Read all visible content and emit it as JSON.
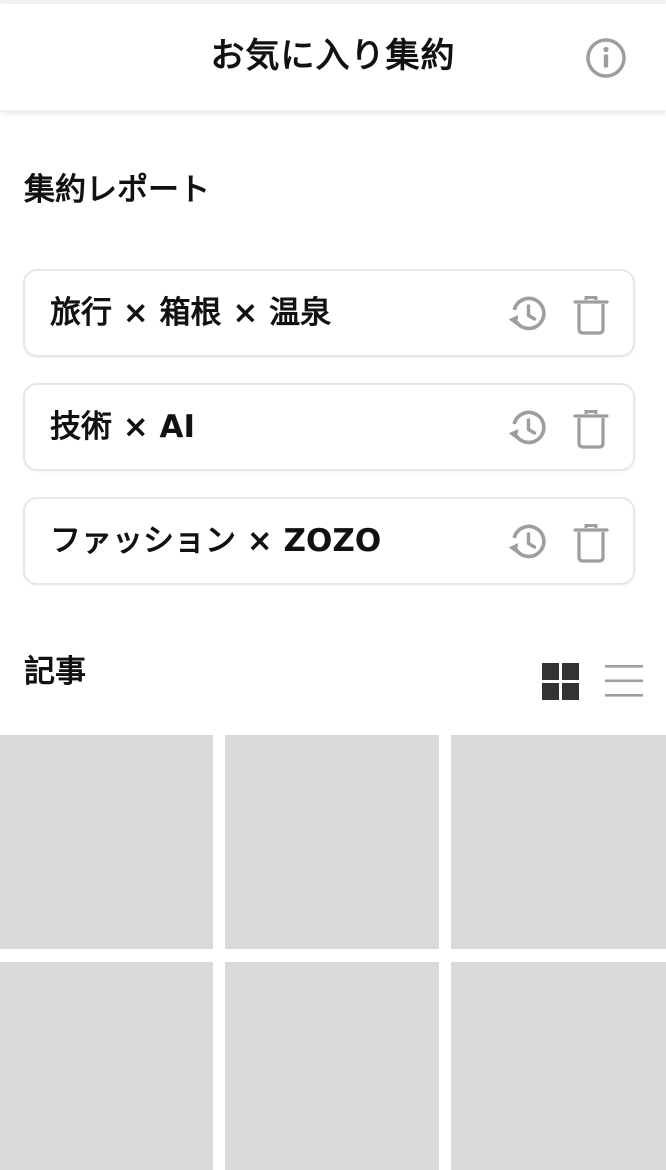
{
  "header": {
    "title": "お気に入り集約",
    "info_icon": "info-circle-icon"
  },
  "reports": {
    "section_title": "集約レポート",
    "items": [
      {
        "label": "旅行 × 箱根 × 温泉"
      },
      {
        "label": "技術 × AI"
      },
      {
        "label": "ファッション × ZOZO"
      }
    ],
    "history_icon": "history-icon",
    "delete_icon": "trash-icon"
  },
  "articles": {
    "section_title": "記事",
    "view_modes": [
      {
        "name": "grid",
        "icon": "grid-view-icon",
        "active": true
      },
      {
        "name": "list",
        "icon": "list-view-icon",
        "active": false
      }
    ],
    "tiles_count": 6
  },
  "colors": {
    "text": "#111111",
    "icon_gray": "#9e9e9e",
    "active_icon": "#333333",
    "tile": "#d9d9d9",
    "card_border": "#e7e7e7"
  }
}
